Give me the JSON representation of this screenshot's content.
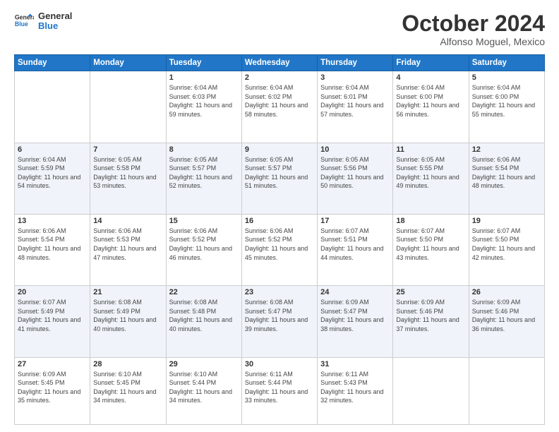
{
  "header": {
    "logo_line1": "General",
    "logo_line2": "Blue",
    "month": "October 2024",
    "location": "Alfonso Moguel, Mexico"
  },
  "days_of_week": [
    "Sunday",
    "Monday",
    "Tuesday",
    "Wednesday",
    "Thursday",
    "Friday",
    "Saturday"
  ],
  "weeks": [
    [
      {
        "day": "",
        "info": ""
      },
      {
        "day": "",
        "info": ""
      },
      {
        "day": "1",
        "info": "Sunrise: 6:04 AM\nSunset: 6:03 PM\nDaylight: 11 hours and 59 minutes."
      },
      {
        "day": "2",
        "info": "Sunrise: 6:04 AM\nSunset: 6:02 PM\nDaylight: 11 hours and 58 minutes."
      },
      {
        "day": "3",
        "info": "Sunrise: 6:04 AM\nSunset: 6:01 PM\nDaylight: 11 hours and 57 minutes."
      },
      {
        "day": "4",
        "info": "Sunrise: 6:04 AM\nSunset: 6:00 PM\nDaylight: 11 hours and 56 minutes."
      },
      {
        "day": "5",
        "info": "Sunrise: 6:04 AM\nSunset: 6:00 PM\nDaylight: 11 hours and 55 minutes."
      }
    ],
    [
      {
        "day": "6",
        "info": "Sunrise: 6:04 AM\nSunset: 5:59 PM\nDaylight: 11 hours and 54 minutes."
      },
      {
        "day": "7",
        "info": "Sunrise: 6:05 AM\nSunset: 5:58 PM\nDaylight: 11 hours and 53 minutes."
      },
      {
        "day": "8",
        "info": "Sunrise: 6:05 AM\nSunset: 5:57 PM\nDaylight: 11 hours and 52 minutes."
      },
      {
        "day": "9",
        "info": "Sunrise: 6:05 AM\nSunset: 5:57 PM\nDaylight: 11 hours and 51 minutes."
      },
      {
        "day": "10",
        "info": "Sunrise: 6:05 AM\nSunset: 5:56 PM\nDaylight: 11 hours and 50 minutes."
      },
      {
        "day": "11",
        "info": "Sunrise: 6:05 AM\nSunset: 5:55 PM\nDaylight: 11 hours and 49 minutes."
      },
      {
        "day": "12",
        "info": "Sunrise: 6:06 AM\nSunset: 5:54 PM\nDaylight: 11 hours and 48 minutes."
      }
    ],
    [
      {
        "day": "13",
        "info": "Sunrise: 6:06 AM\nSunset: 5:54 PM\nDaylight: 11 hours and 48 minutes."
      },
      {
        "day": "14",
        "info": "Sunrise: 6:06 AM\nSunset: 5:53 PM\nDaylight: 11 hours and 47 minutes."
      },
      {
        "day": "15",
        "info": "Sunrise: 6:06 AM\nSunset: 5:52 PM\nDaylight: 11 hours and 46 minutes."
      },
      {
        "day": "16",
        "info": "Sunrise: 6:06 AM\nSunset: 5:52 PM\nDaylight: 11 hours and 45 minutes."
      },
      {
        "day": "17",
        "info": "Sunrise: 6:07 AM\nSunset: 5:51 PM\nDaylight: 11 hours and 44 minutes."
      },
      {
        "day": "18",
        "info": "Sunrise: 6:07 AM\nSunset: 5:50 PM\nDaylight: 11 hours and 43 minutes."
      },
      {
        "day": "19",
        "info": "Sunrise: 6:07 AM\nSunset: 5:50 PM\nDaylight: 11 hours and 42 minutes."
      }
    ],
    [
      {
        "day": "20",
        "info": "Sunrise: 6:07 AM\nSunset: 5:49 PM\nDaylight: 11 hours and 41 minutes."
      },
      {
        "day": "21",
        "info": "Sunrise: 6:08 AM\nSunset: 5:49 PM\nDaylight: 11 hours and 40 minutes."
      },
      {
        "day": "22",
        "info": "Sunrise: 6:08 AM\nSunset: 5:48 PM\nDaylight: 11 hours and 40 minutes."
      },
      {
        "day": "23",
        "info": "Sunrise: 6:08 AM\nSunset: 5:47 PM\nDaylight: 11 hours and 39 minutes."
      },
      {
        "day": "24",
        "info": "Sunrise: 6:09 AM\nSunset: 5:47 PM\nDaylight: 11 hours and 38 minutes."
      },
      {
        "day": "25",
        "info": "Sunrise: 6:09 AM\nSunset: 5:46 PM\nDaylight: 11 hours and 37 minutes."
      },
      {
        "day": "26",
        "info": "Sunrise: 6:09 AM\nSunset: 5:46 PM\nDaylight: 11 hours and 36 minutes."
      }
    ],
    [
      {
        "day": "27",
        "info": "Sunrise: 6:09 AM\nSunset: 5:45 PM\nDaylight: 11 hours and 35 minutes."
      },
      {
        "day": "28",
        "info": "Sunrise: 6:10 AM\nSunset: 5:45 PM\nDaylight: 11 hours and 34 minutes."
      },
      {
        "day": "29",
        "info": "Sunrise: 6:10 AM\nSunset: 5:44 PM\nDaylight: 11 hours and 34 minutes."
      },
      {
        "day": "30",
        "info": "Sunrise: 6:11 AM\nSunset: 5:44 PM\nDaylight: 11 hours and 33 minutes."
      },
      {
        "day": "31",
        "info": "Sunrise: 6:11 AM\nSunset: 5:43 PM\nDaylight: 11 hours and 32 minutes."
      },
      {
        "day": "",
        "info": ""
      },
      {
        "day": "",
        "info": ""
      }
    ]
  ]
}
